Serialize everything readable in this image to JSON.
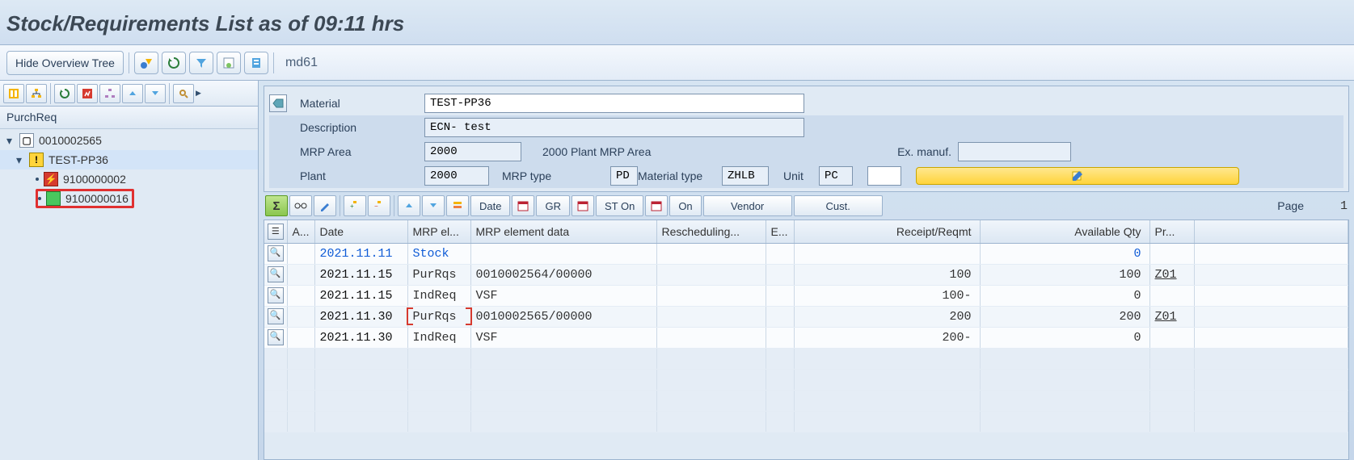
{
  "title": "Stock/Requirements List as of 09:11 hrs",
  "main_toolbar": {
    "hide_tree": "Hide Overview Tree",
    "tcode": "md61"
  },
  "tree": {
    "header": "PurchReq",
    "root": "0010002565",
    "mat": "TEST-PP36",
    "order_red": "9100000002",
    "order_green": "9100000016"
  },
  "mat_form": {
    "labels": {
      "material": "Material",
      "description": "Description",
      "mrp_area": "MRP Area",
      "plant": "Plant",
      "mrp_type": "MRP type",
      "material_type": "Material type",
      "unit": "Unit",
      "ex_manuf": "Ex. manuf."
    },
    "values": {
      "material": "TEST-PP36",
      "description": "ECN- test",
      "mrp_area": "2000",
      "mrp_area_text": "2000 Plant  MRP Area",
      "plant": "2000",
      "mrp_type": "PD",
      "material_type": "ZHLB",
      "unit": "PC",
      "ex_manuf": ""
    }
  },
  "list_toolbar": {
    "date": "Date",
    "gr": "GR",
    "st_on": "ST On",
    "on": "On",
    "vendor": "Vendor",
    "cust": "Cust.",
    "page_label": "Page",
    "page_num": "1"
  },
  "list": {
    "columns": {
      "a": "A...",
      "date": "Date",
      "mrp_el": "MRP el...",
      "mrp_data": "MRP element data",
      "resched": "Rescheduling...",
      "e": "E...",
      "receipt_reqmt": "Receipt/Reqmt",
      "avail_qty": "Available Qty",
      "pr": "Pr..."
    },
    "rows": [
      {
        "date": "2021.11.11",
        "date_blue": true,
        "mrp_el": "Stock",
        "mrp_data": "",
        "resched": "",
        "e": "",
        "receipt": "",
        "avail": "0",
        "pr": "",
        "bracket": false
      },
      {
        "date": "2021.11.15",
        "date_blue": false,
        "mrp_el": "PurRqs",
        "mrp_data": "0010002564/00000",
        "resched": "",
        "e": "",
        "receipt": "100",
        "avail": "100",
        "pr": "Z01",
        "bracket": false
      },
      {
        "date": "2021.11.15",
        "date_blue": false,
        "mrp_el": "IndReq",
        "mrp_data": "VSF",
        "resched": "",
        "e": "",
        "receipt": "100-",
        "avail": "0",
        "pr": "",
        "bracket": false
      },
      {
        "date": "2021.11.30",
        "date_blue": false,
        "mrp_el": "PurRqs",
        "mrp_data": "0010002565/00000",
        "resched": "",
        "e": "",
        "receipt": "200",
        "avail": "200",
        "pr": "Z01",
        "bracket": true
      },
      {
        "date": "2021.11.30",
        "date_blue": false,
        "mrp_el": "IndReq",
        "mrp_data": "VSF",
        "resched": "",
        "e": "",
        "receipt": "200-",
        "avail": "0",
        "pr": "",
        "bracket": false
      }
    ]
  }
}
